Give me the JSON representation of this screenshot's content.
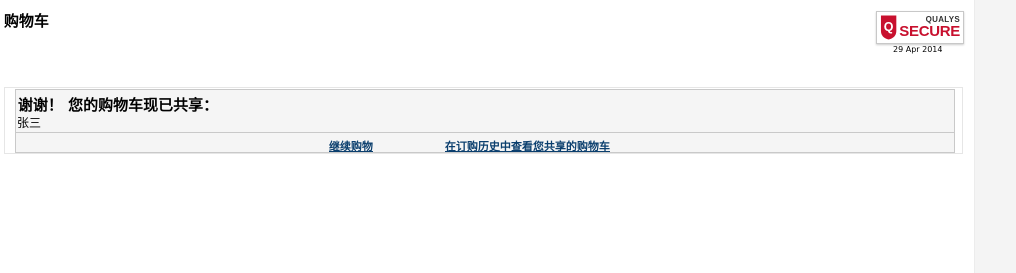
{
  "page": {
    "title": "购物车"
  },
  "badge": {
    "brand": "QUALYS",
    "secure": "SECURE",
    "date": "29 Apr 2014",
    "colors": {
      "shield": "#c8102e",
      "text": "#333333"
    }
  },
  "panel": {
    "heading": "谢谢！ 您的购物车现已共享：",
    "name": "张三",
    "links": {
      "continue_shopping": "继续购物",
      "view_history": "在订购历史中查看您共享的购物车"
    },
    "colors": {
      "link": "#0b3f6e",
      "background": "#f5f5f5",
      "border": "#c9c9c9"
    }
  }
}
